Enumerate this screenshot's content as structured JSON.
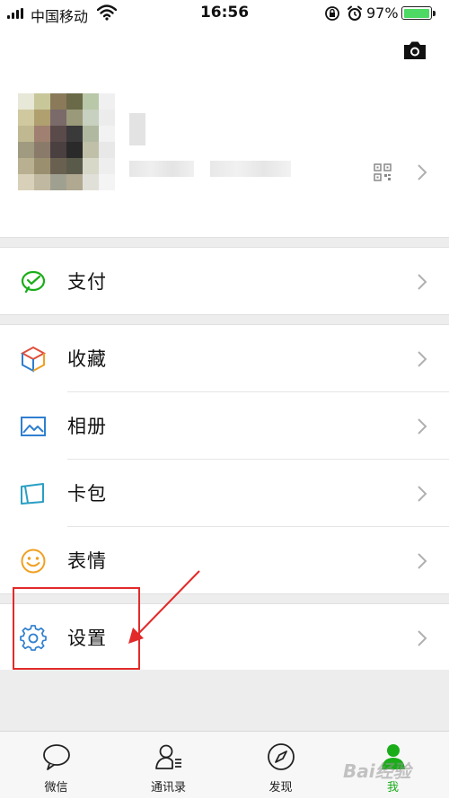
{
  "status_bar": {
    "carrier": "中国移动",
    "time": "16:56",
    "battery_percent": "97%",
    "battery_level": 0.97,
    "battery_color": "#4cd964"
  },
  "profile": {
    "qr_icon": "qr-code-icon",
    "chevron_icon": "chevron-right-icon"
  },
  "menu": {
    "pay": {
      "label": "支付",
      "icon": "wechat-pay-icon",
      "icon_color": "#1aad19"
    },
    "favorites": {
      "label": "收藏",
      "icon": "favorites-cube-icon"
    },
    "album": {
      "label": "相册",
      "icon": "album-icon",
      "icon_color": "#2f7fd0"
    },
    "cards": {
      "label": "卡包",
      "icon": "card-wallet-icon",
      "icon_color": "#2a9fc4"
    },
    "stickers": {
      "label": "表情",
      "icon": "sticker-smile-icon",
      "icon_color": "#f0a023"
    },
    "settings": {
      "label": "设置",
      "icon": "gear-icon",
      "icon_color": "#2f7fd0"
    }
  },
  "tabs": [
    {
      "label": "微信",
      "icon": "chat-bubble-icon"
    },
    {
      "label": "通讯录",
      "icon": "contacts-icon"
    },
    {
      "label": "发现",
      "icon": "compass-icon"
    },
    {
      "label": "我",
      "icon": "me-person-icon",
      "active": true
    }
  ],
  "annotation_color": "#e22a2a",
  "accent_color": "#1aad19",
  "watermark": "Bai经验"
}
